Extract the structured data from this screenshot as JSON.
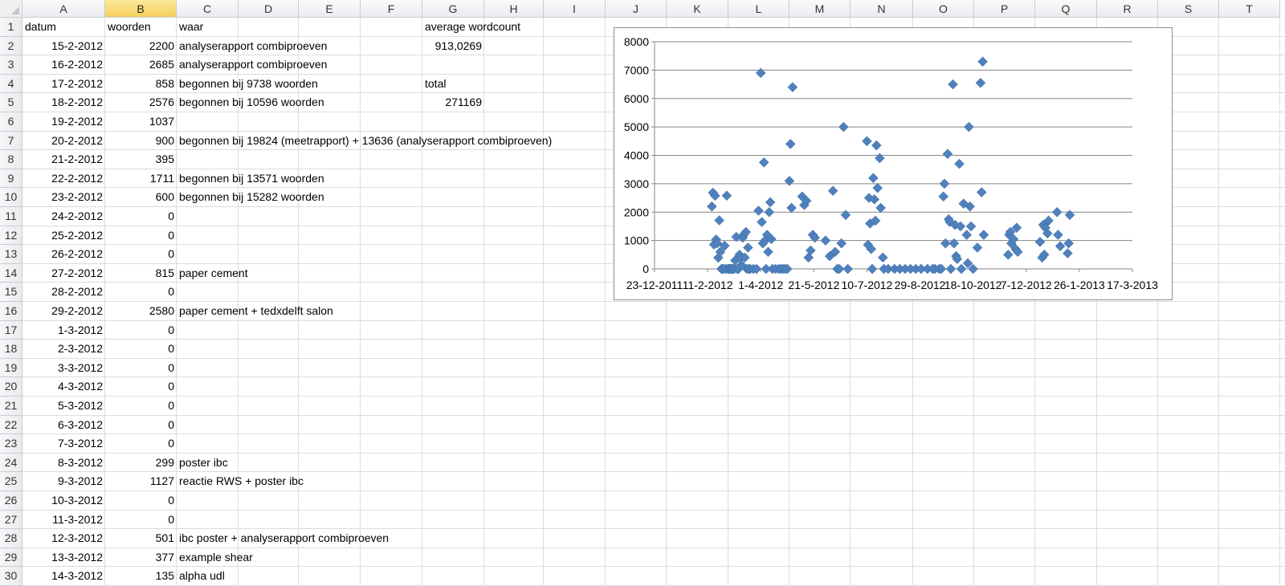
{
  "spreadsheet": {
    "columns": [
      "A",
      "B",
      "C",
      "D",
      "E",
      "F",
      "G",
      "H",
      "I",
      "J",
      "K",
      "L",
      "M",
      "N",
      "O",
      "P",
      "Q",
      "R",
      "S",
      "T"
    ],
    "selected_column": "B",
    "rows": [
      {
        "n": "1",
        "A": "datum",
        "B": "woorden",
        "C": "waar",
        "G": "average wordcount"
      },
      {
        "n": "2",
        "A": "15-2-2012",
        "B": "2200",
        "C": "analyserapport combiproeven",
        "G": "913,0269"
      },
      {
        "n": "3",
        "A": "16-2-2012",
        "B": "2685",
        "C": "analyserapport combiproeven"
      },
      {
        "n": "4",
        "A": "17-2-2012",
        "B": "858",
        "C": "begonnen bij 9738 woorden",
        "G": "total"
      },
      {
        "n": "5",
        "A": "18-2-2012",
        "B": "2576",
        "C": "begonnen bij 10596 woorden",
        "G": "271169"
      },
      {
        "n": "6",
        "A": "19-2-2012",
        "B": "1037"
      },
      {
        "n": "7",
        "A": "20-2-2012",
        "B": "900",
        "C": "begonnen bij 19824 (meetrapport) + 13636 (analyserapport combiproeven)"
      },
      {
        "n": "8",
        "A": "21-2-2012",
        "B": "395"
      },
      {
        "n": "9",
        "A": "22-2-2012",
        "B": "1711",
        "C": "begonnen bij 13571 woorden"
      },
      {
        "n": "10",
        "A": "23-2-2012",
        "B": "600",
        "C": "begonnen bij 15282 woorden"
      },
      {
        "n": "11",
        "A": "24-2-2012",
        "B": "0"
      },
      {
        "n": "12",
        "A": "25-2-2012",
        "B": "0"
      },
      {
        "n": "13",
        "A": "26-2-2012",
        "B": "0"
      },
      {
        "n": "14",
        "A": "27-2-2012",
        "B": "815",
        "C": "paper cement"
      },
      {
        "n": "15",
        "A": "28-2-2012",
        "B": "0"
      },
      {
        "n": "16",
        "A": "29-2-2012",
        "B": "2580",
        "C": "paper cement + tedxdelft salon"
      },
      {
        "n": "17",
        "A": "1-3-2012",
        "B": "0"
      },
      {
        "n": "18",
        "A": "2-3-2012",
        "B": "0"
      },
      {
        "n": "19",
        "A": "3-3-2012",
        "B": "0"
      },
      {
        "n": "20",
        "A": "4-3-2012",
        "B": "0"
      },
      {
        "n": "21",
        "A": "5-3-2012",
        "B": "0"
      },
      {
        "n": "22",
        "A": "6-3-2012",
        "B": "0"
      },
      {
        "n": "23",
        "A": "7-3-2012",
        "B": "0"
      },
      {
        "n": "24",
        "A": "8-3-2012",
        "B": "299",
        "C": "poster ibc"
      },
      {
        "n": "25",
        "A": "9-3-2012",
        "B": "1127",
        "C": "reactie RWS + poster ibc"
      },
      {
        "n": "26",
        "A": "10-3-2012",
        "B": "0"
      },
      {
        "n": "27",
        "A": "11-3-2012",
        "B": "0"
      },
      {
        "n": "28",
        "A": "12-3-2012",
        "B": "501",
        "C": "ibc poster + analyserapport combiproeven"
      },
      {
        "n": "29",
        "A": "13-3-2012",
        "B": "377",
        "C": "example shear"
      },
      {
        "n": "30",
        "A": "14-3-2012",
        "B": "135",
        "C": "alpha udl"
      }
    ]
  },
  "chart_data": {
    "type": "scatter",
    "title": "",
    "xlabel": "",
    "ylabel": "",
    "marker_color": "#4f81bd",
    "grid": true,
    "legend": "none",
    "xlim": [
      "2011-12-23",
      "2013-03-17"
    ],
    "ylim": [
      0,
      8000
    ],
    "x_tick_labels": [
      "23-12-2011",
      "11-2-2012",
      "1-4-2012",
      "21-5-2012",
      "10-7-2012",
      "29-8-2012",
      "18-10-2012",
      "7-12-2012",
      "26-1-2013",
      "17-3-2013"
    ],
    "y_tick_labels": [
      "0",
      "1000",
      "2000",
      "3000",
      "4000",
      "5000",
      "6000",
      "7000",
      "8000"
    ],
    "points": [
      [
        "2012-02-15",
        2200
      ],
      [
        "2012-02-16",
        2685
      ],
      [
        "2012-02-17",
        858
      ],
      [
        "2012-02-18",
        2576
      ],
      [
        "2012-02-19",
        1037
      ],
      [
        "2012-02-20",
        900
      ],
      [
        "2012-02-21",
        395
      ],
      [
        "2012-02-22",
        1711
      ],
      [
        "2012-02-23",
        600
      ],
      [
        "2012-02-24",
        0
      ],
      [
        "2012-02-25",
        0
      ],
      [
        "2012-02-26",
        0
      ],
      [
        "2012-02-27",
        815
      ],
      [
        "2012-02-28",
        0
      ],
      [
        "2012-02-29",
        2580
      ],
      [
        "2012-03-01",
        0
      ],
      [
        "2012-03-02",
        0
      ],
      [
        "2012-03-03",
        0
      ],
      [
        "2012-03-04",
        0
      ],
      [
        "2012-03-05",
        0
      ],
      [
        "2012-03-06",
        0
      ],
      [
        "2012-03-07",
        0
      ],
      [
        "2012-03-08",
        299
      ],
      [
        "2012-03-09",
        1127
      ],
      [
        "2012-03-10",
        0
      ],
      [
        "2012-03-11",
        0
      ],
      [
        "2012-03-12",
        501
      ],
      [
        "2012-03-13",
        377
      ],
      [
        "2012-03-14",
        135
      ],
      [
        "2012-03-15",
        1100
      ],
      [
        "2012-03-16",
        1200
      ],
      [
        "2012-03-17",
        400
      ],
      [
        "2012-03-18",
        1300
      ],
      [
        "2012-03-19",
        0
      ],
      [
        "2012-03-20",
        750
      ],
      [
        "2012-03-21",
        0
      ],
      [
        "2012-03-22",
        0
      ],
      [
        "2012-03-25",
        0
      ],
      [
        "2012-03-28",
        0
      ],
      [
        "2012-03-30",
        2050
      ],
      [
        "2012-04-01",
        6900
      ],
      [
        "2012-04-02",
        1650
      ],
      [
        "2012-04-03",
        900
      ],
      [
        "2012-04-04",
        3750
      ],
      [
        "2012-04-05",
        1000
      ],
      [
        "2012-04-06",
        0
      ],
      [
        "2012-04-07",
        1200
      ],
      [
        "2012-04-08",
        600
      ],
      [
        "2012-04-09",
        2000
      ],
      [
        "2012-04-10",
        2350
      ],
      [
        "2012-04-11",
        1050
      ],
      [
        "2012-04-12",
        0
      ],
      [
        "2012-04-15",
        0
      ],
      [
        "2012-04-18",
        0
      ],
      [
        "2012-04-20",
        0
      ],
      [
        "2012-04-22",
        0
      ],
      [
        "2012-04-24",
        0
      ],
      [
        "2012-04-26",
        0
      ],
      [
        "2012-04-28",
        3100
      ],
      [
        "2012-04-29",
        4400
      ],
      [
        "2012-04-30",
        2150
      ],
      [
        "2012-05-01",
        6400
      ],
      [
        "2012-05-10",
        2550
      ],
      [
        "2012-05-12",
        2250
      ],
      [
        "2012-05-14",
        2400
      ],
      [
        "2012-05-16",
        400
      ],
      [
        "2012-05-18",
        650
      ],
      [
        "2012-05-20",
        1200
      ],
      [
        "2012-05-22",
        1100
      ],
      [
        "2012-06-01",
        1000
      ],
      [
        "2012-06-05",
        450
      ],
      [
        "2012-06-08",
        2750
      ],
      [
        "2012-06-10",
        600
      ],
      [
        "2012-06-12",
        0
      ],
      [
        "2012-06-14",
        0
      ],
      [
        "2012-06-16",
        900
      ],
      [
        "2012-06-18",
        5000
      ],
      [
        "2012-06-20",
        1900
      ],
      [
        "2012-06-22",
        0
      ],
      [
        "2012-07-10",
        4500
      ],
      [
        "2012-07-11",
        850
      ],
      [
        "2012-07-12",
        2500
      ],
      [
        "2012-07-13",
        1600
      ],
      [
        "2012-07-14",
        700
      ],
      [
        "2012-07-15",
        0
      ],
      [
        "2012-07-16",
        3200
      ],
      [
        "2012-07-17",
        2450
      ],
      [
        "2012-07-18",
        1700
      ],
      [
        "2012-07-19",
        4350
      ],
      [
        "2012-07-20",
        2850
      ],
      [
        "2012-07-22",
        3900
      ],
      [
        "2012-07-23",
        2150
      ],
      [
        "2012-07-25",
        400
      ],
      [
        "2012-07-26",
        0
      ],
      [
        "2012-07-30",
        0
      ],
      [
        "2012-08-05",
        0
      ],
      [
        "2012-08-10",
        0
      ],
      [
        "2012-08-15",
        0
      ],
      [
        "2012-08-20",
        0
      ],
      [
        "2012-08-25",
        0
      ],
      [
        "2012-08-30",
        0
      ],
      [
        "2012-09-05",
        0
      ],
      [
        "2012-09-10",
        0
      ],
      [
        "2012-09-12",
        0
      ],
      [
        "2012-09-16",
        0
      ],
      [
        "2012-09-18",
        0
      ],
      [
        "2012-09-20",
        2550
      ],
      [
        "2012-09-21",
        3000
      ],
      [
        "2012-09-22",
        900
      ],
      [
        "2012-09-24",
        4050
      ],
      [
        "2012-09-25",
        1750
      ],
      [
        "2012-09-26",
        1650
      ],
      [
        "2012-09-27",
        0
      ],
      [
        "2012-09-29",
        6500
      ],
      [
        "2012-09-30",
        900
      ],
      [
        "2012-10-01",
        1550
      ],
      [
        "2012-10-02",
        450
      ],
      [
        "2012-10-03",
        350
      ],
      [
        "2012-10-05",
        3700
      ],
      [
        "2012-10-06",
        1500
      ],
      [
        "2012-10-07",
        0
      ],
      [
        "2012-10-09",
        2300
      ],
      [
        "2012-10-12",
        1200
      ],
      [
        "2012-10-13",
        200
      ],
      [
        "2012-10-14",
        5000
      ],
      [
        "2012-10-15",
        2200
      ],
      [
        "2012-10-16",
        1500
      ],
      [
        "2012-10-18",
        0
      ],
      [
        "2012-10-22",
        750
      ],
      [
        "2012-10-25",
        6550
      ],
      [
        "2012-10-26",
        2700
      ],
      [
        "2012-10-27",
        7300
      ],
      [
        "2012-10-28",
        1200
      ],
      [
        "2012-11-20",
        500
      ],
      [
        "2012-11-21",
        1200
      ],
      [
        "2012-11-22",
        1300
      ],
      [
        "2012-11-23",
        900
      ],
      [
        "2012-11-25",
        1050
      ],
      [
        "2012-11-27",
        700
      ],
      [
        "2012-11-28",
        1450
      ],
      [
        "2012-11-29",
        600
      ],
      [
        "2012-12-20",
        950
      ],
      [
        "2012-12-22",
        400
      ],
      [
        "2012-12-23",
        1550
      ],
      [
        "2012-12-24",
        500
      ],
      [
        "2012-12-25",
        1450
      ],
      [
        "2012-12-27",
        1250
      ],
      [
        "2012-12-28",
        1700
      ],
      [
        "2013-01-05",
        2000
      ],
      [
        "2013-01-06",
        1200
      ],
      [
        "2013-01-08",
        800
      ],
      [
        "2013-01-15",
        550
      ],
      [
        "2013-01-16",
        900
      ],
      [
        "2013-01-17",
        1900
      ]
    ]
  }
}
